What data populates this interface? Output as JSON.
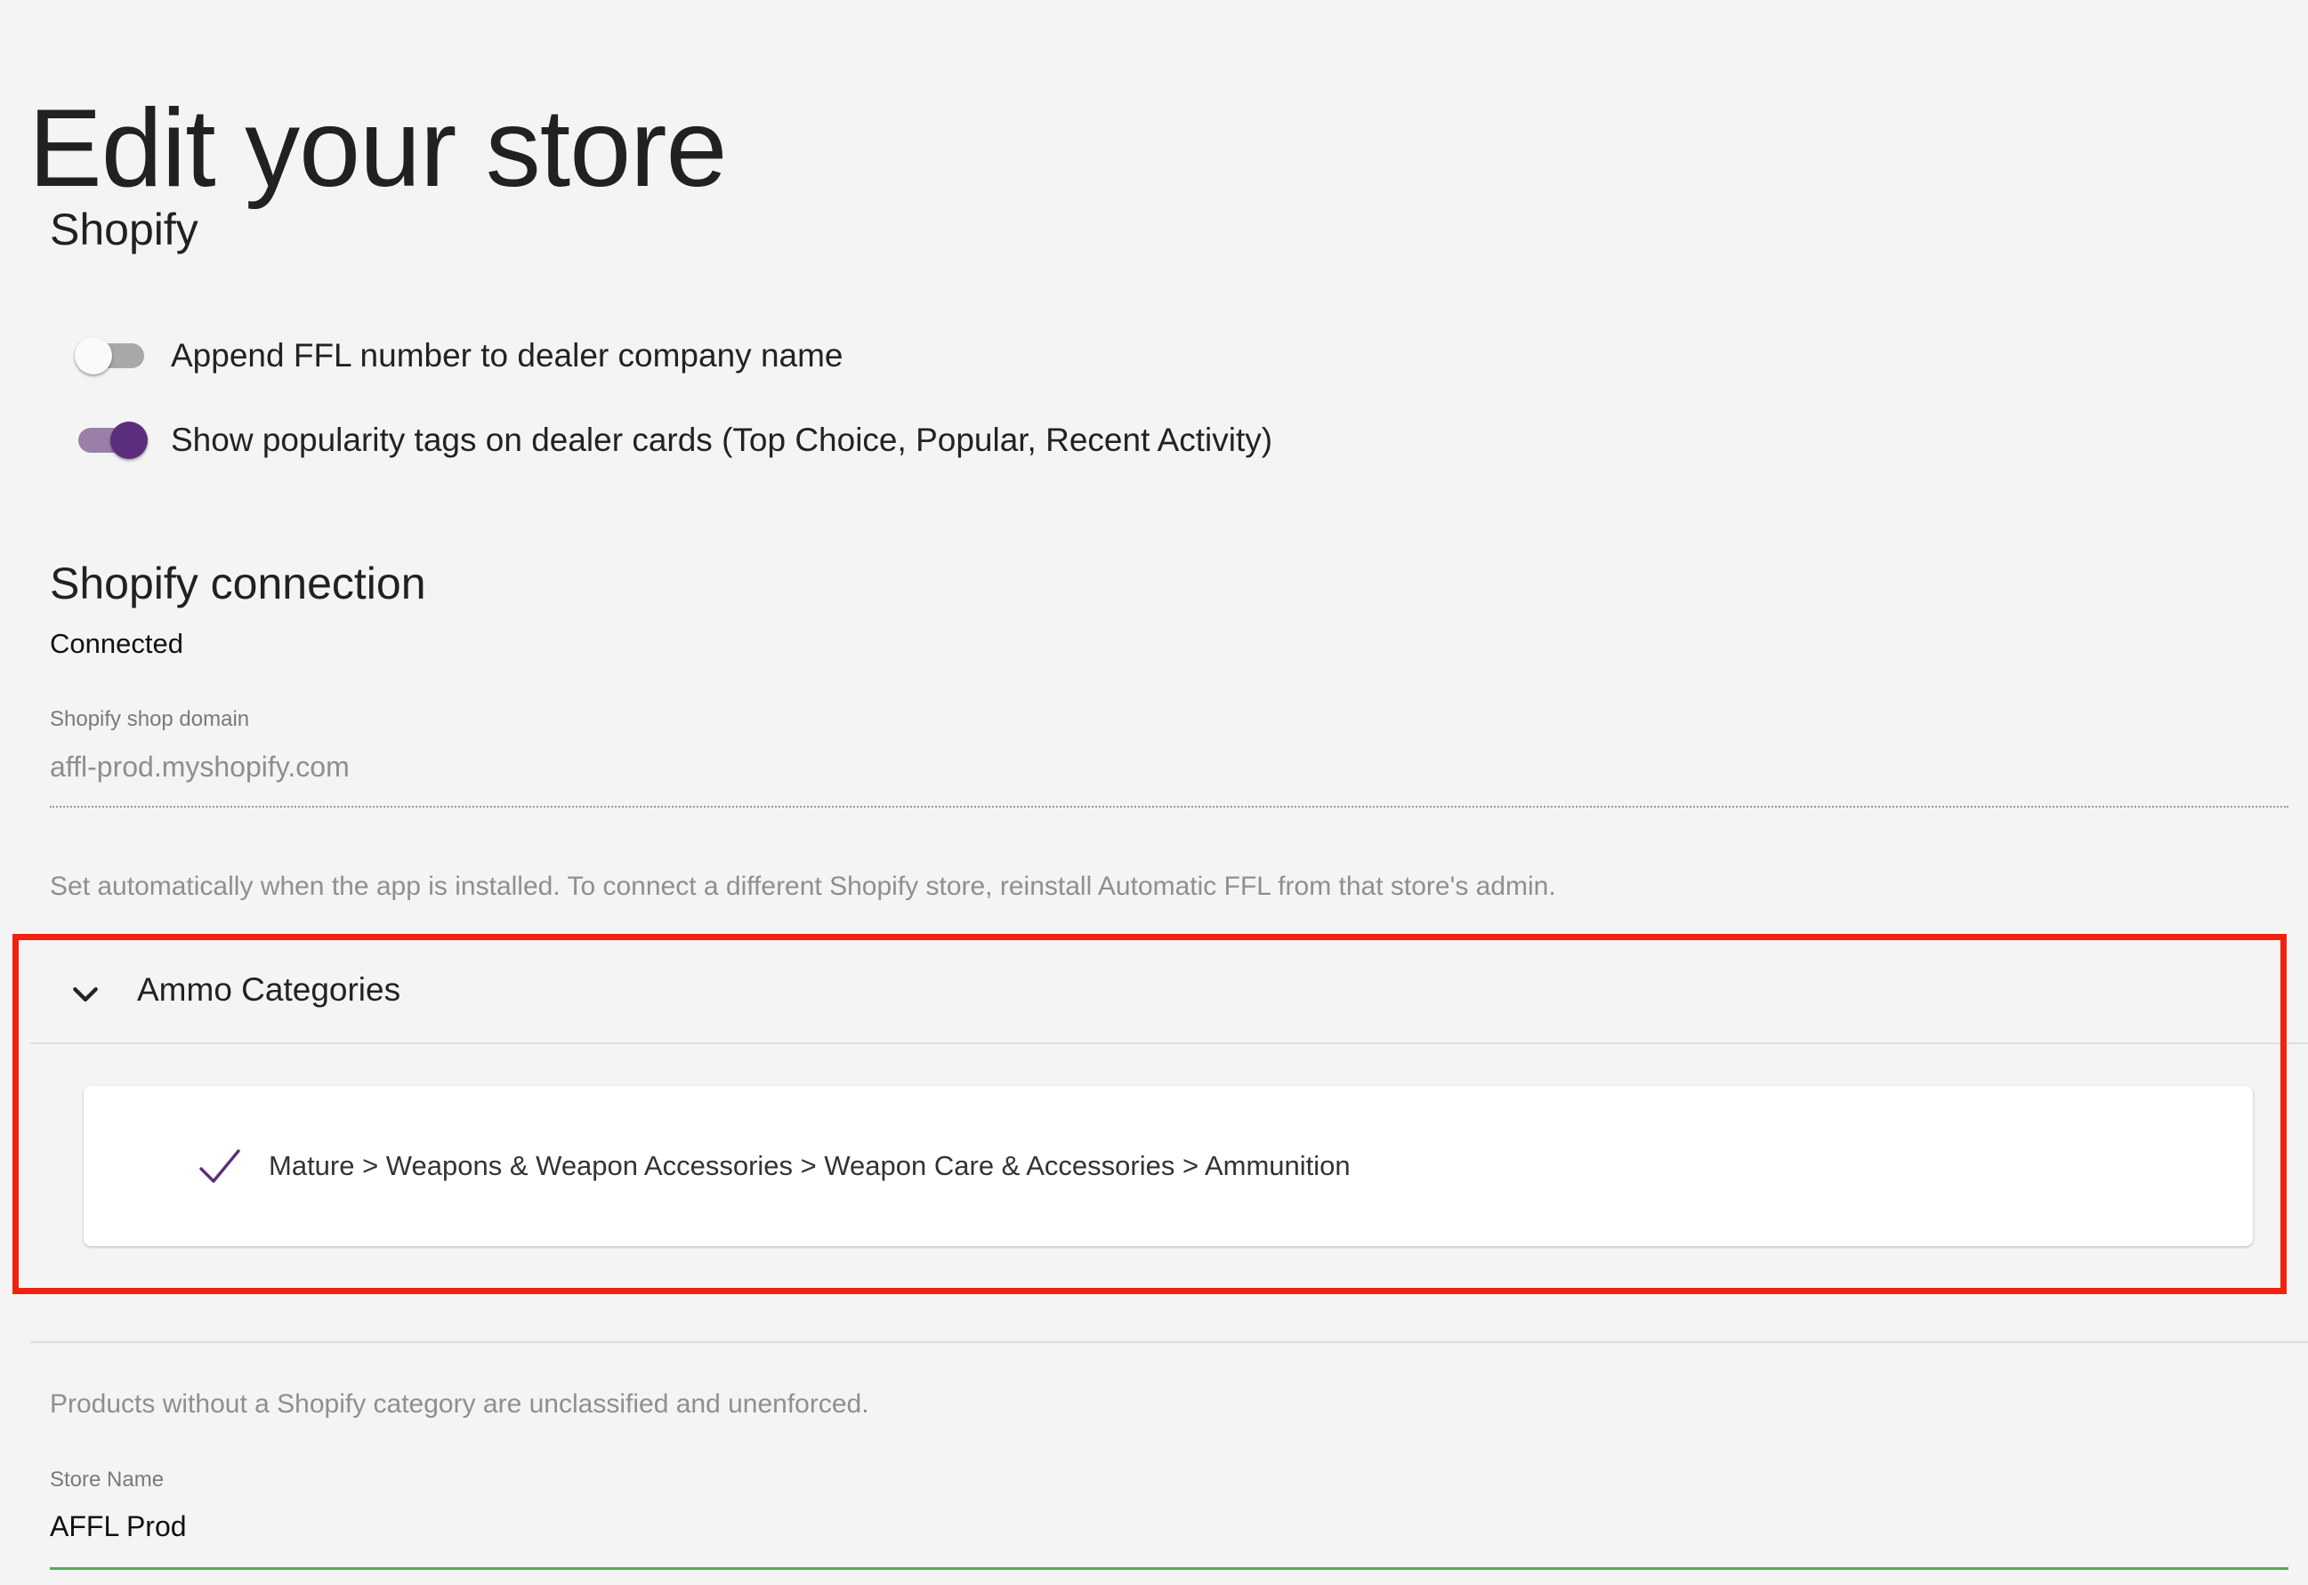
{
  "page": {
    "title": "Edit your store"
  },
  "shopify": {
    "heading": "Shopify",
    "toggles": [
      {
        "label": "Append FFL number to dealer company name",
        "checked": false
      },
      {
        "label": "Show popularity tags on dealer cards (Top Choice, Popular, Recent Activity)",
        "checked": true
      }
    ]
  },
  "connection": {
    "heading": "Shopify connection",
    "status": "Connected",
    "domain_label": "Shopify shop domain",
    "domain_value": "affl-prod.myshopify.com",
    "domain_helper": "Set automatically when the app is installed. To connect a different Shopify store, reinstall Automatic FFL from that store's admin."
  },
  "ammo_categories": {
    "title": "Ammo Categories",
    "expanded": true,
    "items": [
      {
        "label": "Mature > Weapons & Weapon Accessories > Weapon Care & Accessories > Ammunition",
        "selected": true
      }
    ],
    "helper": "Products without a Shopify category are unclassified and unenforced."
  },
  "store_name": {
    "label": "Store Name",
    "value": "AFFL Prod"
  },
  "colors": {
    "accent_purple": "#5c2e7e",
    "highlight_red": "#f0220d",
    "input_focus_green": "#4caf50",
    "background": "#f4f4f4"
  },
  "icons": {
    "accordion": "chevron-down-icon",
    "selected": "check-icon"
  }
}
